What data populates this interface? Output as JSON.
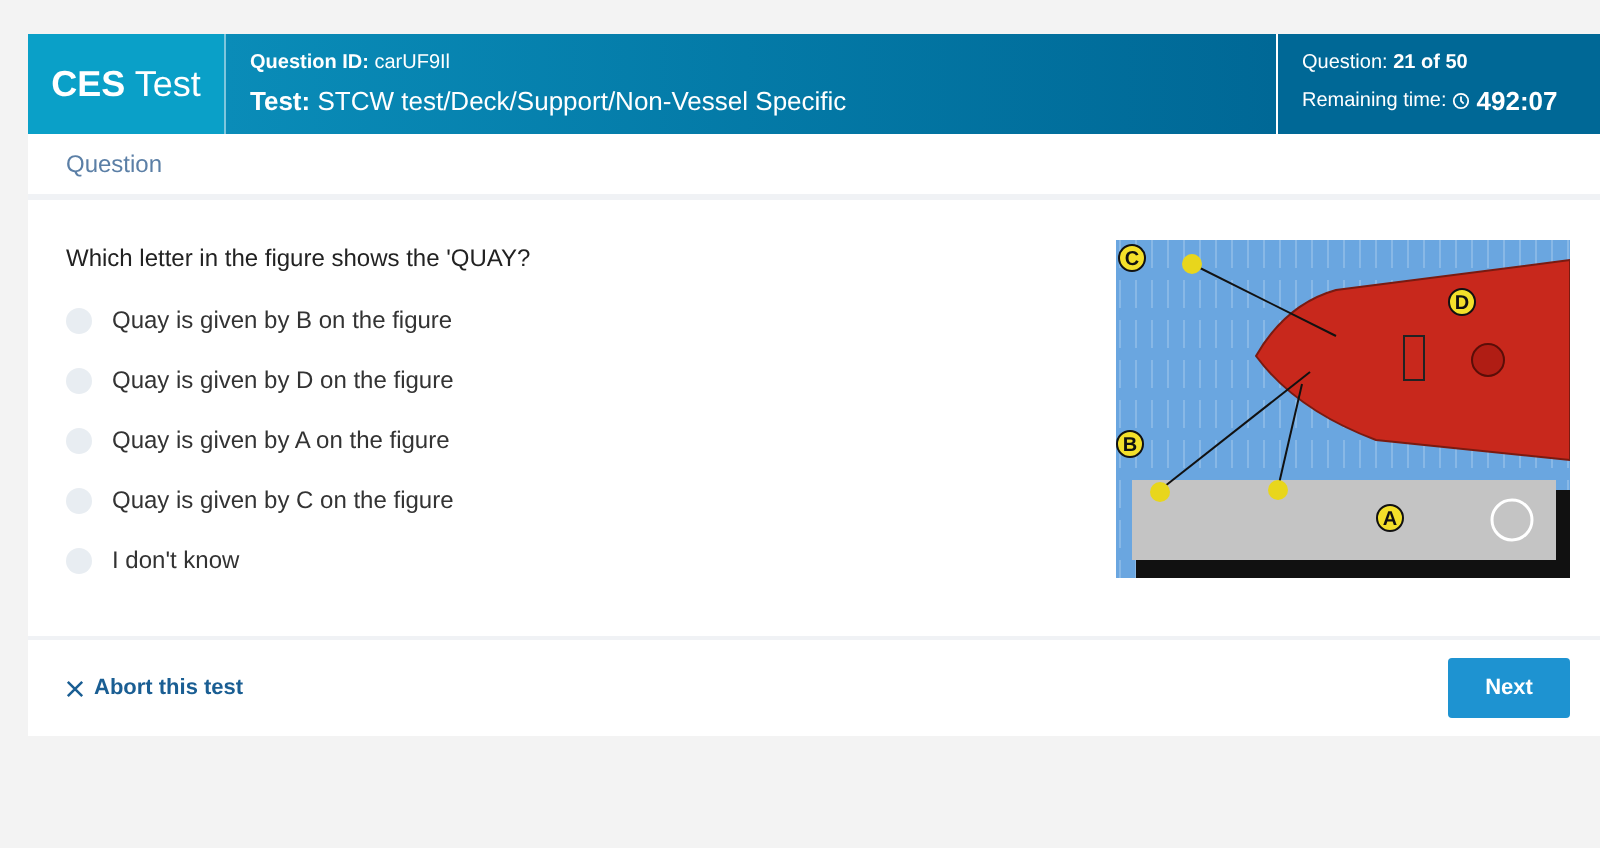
{
  "header": {
    "brand_bold": "CES",
    "brand_light": "Test",
    "question_id_label": "Question ID:",
    "question_id": "carUF9Il",
    "test_label": "Test:",
    "test": "STCW test/Deck/Support/Non-Vessel Specific",
    "progress_label": "Question:",
    "progress": "21 of 50",
    "time_label": "Remaining time:",
    "time": "492:07"
  },
  "section_title": "Question",
  "question": "Which letter in the figure shows the 'QUAY?",
  "options": [
    {
      "label": "Quay is given by B on the figure",
      "selected": false
    },
    {
      "label": "Quay is given by D on the figure",
      "selected": false
    },
    {
      "label": "Quay is given by A on the figure",
      "selected": false
    },
    {
      "label": "Quay is given by C on the figure",
      "selected": false
    },
    {
      "label": "I don't know",
      "selected": false
    }
  ],
  "figure": {
    "labels": [
      "C",
      "D",
      "B",
      "A"
    ]
  },
  "footer": {
    "abort": "Abort this test",
    "next": "Next"
  }
}
